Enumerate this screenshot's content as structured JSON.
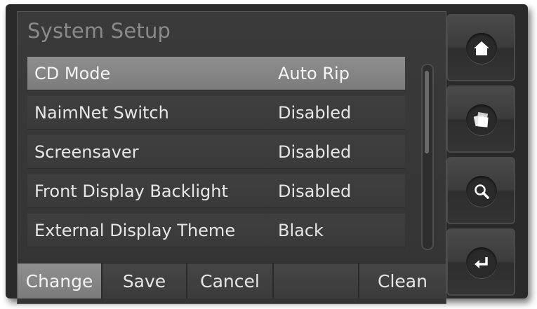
{
  "screen": {
    "title": "System Setup",
    "settings": [
      {
        "name": "CD Mode",
        "value": "Auto Rip",
        "selected": true
      },
      {
        "name": "NaimNet Switch",
        "value": "Disabled",
        "selected": false
      },
      {
        "name": "Screensaver",
        "value": "Disabled",
        "selected": false
      },
      {
        "name": "Front Display Backlight",
        "value": "Disabled",
        "selected": false
      },
      {
        "name": "External Display Theme",
        "value": "Black",
        "selected": false
      }
    ],
    "scroll_position": 0.0
  },
  "bottom_bar": {
    "change_label": "Change",
    "save_label": "Save",
    "cancel_label": "Cancel",
    "empty_label": "",
    "clean_label": "Clean",
    "active": "Change"
  },
  "side_buttons": [
    {
      "icon": "home-icon"
    },
    {
      "icon": "albums-icon"
    },
    {
      "icon": "search-icon"
    },
    {
      "icon": "enter-icon"
    }
  ],
  "colors": {
    "selected_row": "#858585",
    "text": "#e6e6e6",
    "title": "#8a8a8a",
    "background": "#383838"
  }
}
